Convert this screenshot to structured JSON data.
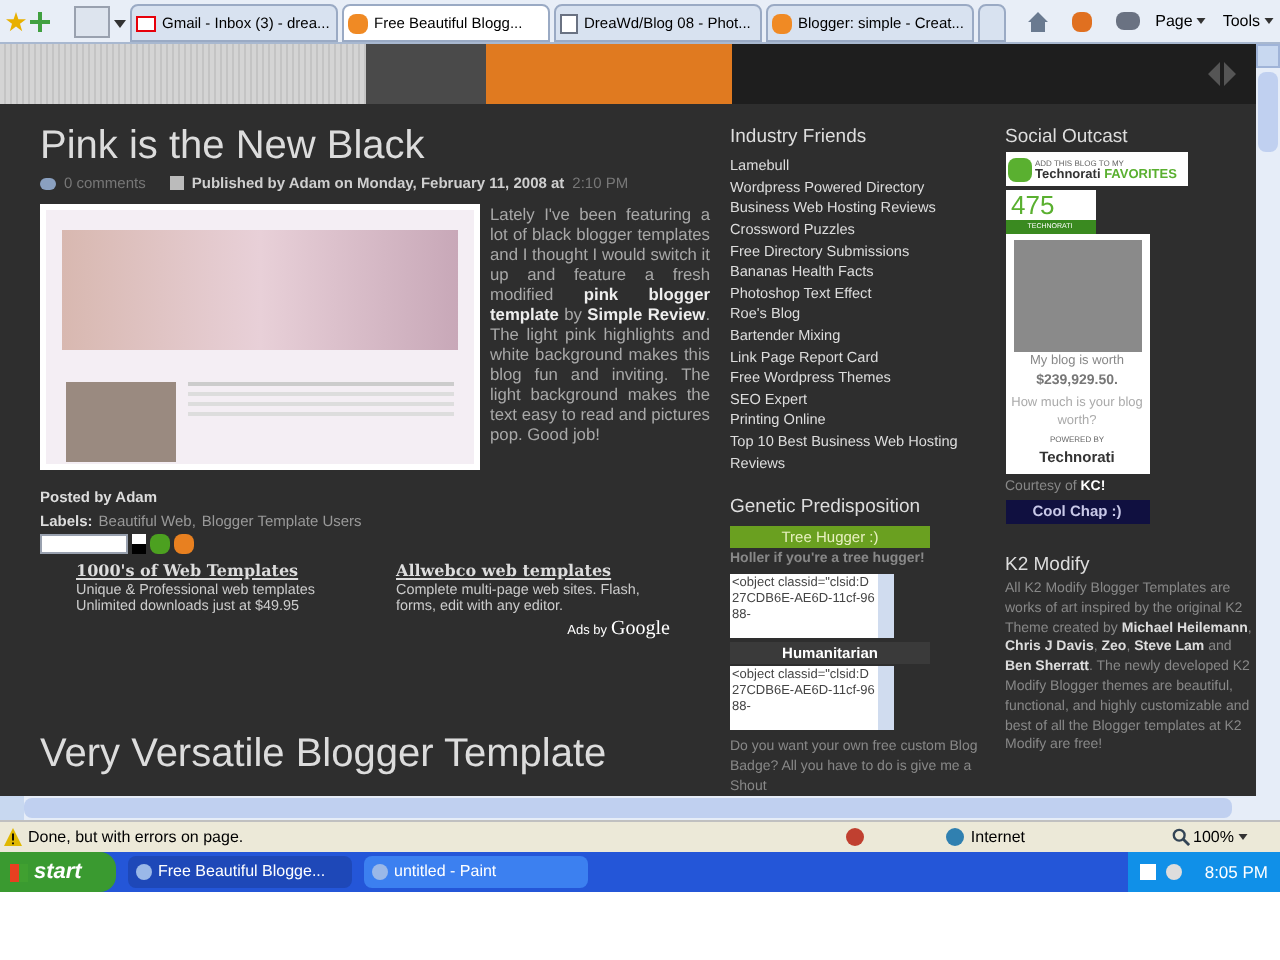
{
  "browser": {
    "tabs": [
      {
        "label": "Gmail - Inbox (3) - drea...",
        "kind": "mail",
        "selected": false
      },
      {
        "label": "Free Beautiful Blogg...",
        "kind": "blogger",
        "selected": true
      },
      {
        "label": "DreaWd/Blog 08 - Phot...",
        "kind": "page",
        "selected": false
      },
      {
        "label": "Blogger: simple - Creat...",
        "kind": "blogger",
        "selected": false
      }
    ],
    "toolbar": [
      "Page",
      "Tools"
    ]
  },
  "post": {
    "title": "Pink is the New Black",
    "comments": "0 comments",
    "meta": "Published by Adam on Monday, February 11, 2008 at",
    "time": "2:10 PM",
    "body": "Lately I've been featuring a lot of black blogger templates and I thought I would switch it up and feature a fresh modified **pink blogger template** by **Simple Review**. The light pink highlights and white background makes this blog fun and inviting. The light background makes the text easy to read and pictures pop. Good job!",
    "posted_by": "Posted by Adam",
    "labels_prefix": "Labels:",
    "labels": [
      "Beautiful Web,",
      "Blogger Template Users"
    ],
    "ads": [
      {
        "title": "1000's of Web Templates",
        "lines": [
          "Unique & Professional web templates",
          "Unlimited downloads just at $49.95"
        ]
      },
      {
        "title": "Allwebco web templates",
        "lines": [
          "Complete multi-page web sites. Flash,",
          "forms, edit with any editor."
        ]
      }
    ],
    "ads_by": "Ads by",
    "ads_brand": "Google"
  },
  "next_post": {
    "title": "Very Versatile Blogger Template"
  },
  "industry_friends": {
    "heading": "Industry Friends",
    "links": [
      "Lamebull",
      "Wordpress Powered Directory",
      "Business Web Hosting Reviews",
      "Crossword Puzzles",
      "Free Directory Submissions",
      "Bananas Health Facts",
      "Photoshop Text Effect",
      "Roe's Blog",
      "Bartender Mixing",
      "Link Page Report Card",
      "Free Wordpress Themes",
      "SEO Expert",
      "Printing Online",
      "Top 10 Best Business Web Hosting Reviews"
    ]
  },
  "genetic": {
    "heading": "Genetic Predisposition",
    "badges": [
      {
        "label": "Tree Hugger :)",
        "kind": "green",
        "caption": "Holler if you're a tree hugger!",
        "code": "<object classid=\"clsid:D27CDB6E-AE6D-11cf-9688-"
      },
      {
        "label": "Humanitarian",
        "kind": "dark",
        "code": "<object classid=\"clsid:D27CDB6E-AE6D-11cf-9688-"
      }
    ],
    "note": "Do you want your own free custom Blog Badge? All you have to do is give me a Shout"
  },
  "social": {
    "heading": "Social Outcast",
    "fav_small": "ADD THIS BLOG TO MY",
    "fav_brand": "Technorati",
    "fav_label": "FAVORITES",
    "rank": "475",
    "rank_label": "TECHNORATI",
    "worth_lines": [
      "My blog is worth",
      "$239,929.50.",
      "How much is your blog worth?"
    ],
    "powered": "POWERED BY",
    "powered_brand": "Technorati",
    "courtesy": "Courtesy of **KC!**",
    "cool": "Cool Chap :)"
  },
  "k2": {
    "heading": "K2 Modify",
    "text": "All K2 Modify Blogger Templates are works of art inspired by the original K2 Theme created by **Michael Heilemann**, **Chris J Davis**, **Zeo**, **Steve Lam** and **Ben Sherratt**. The newly developed K2 Modify Blogger themes are beautiful, functional, and highly customizable and best of all the Blogger templates at K2 Modify are free!"
  },
  "status": {
    "text": "Done, but with errors on page.",
    "zone": "Internet",
    "zoom": "100%"
  },
  "taskbar": {
    "start": "start",
    "tasks": [
      {
        "label": "Free Beautiful Blogge...",
        "selected": false
      },
      {
        "label": "untitled - Paint",
        "selected": true
      }
    ],
    "clock": "8:05 PM"
  }
}
